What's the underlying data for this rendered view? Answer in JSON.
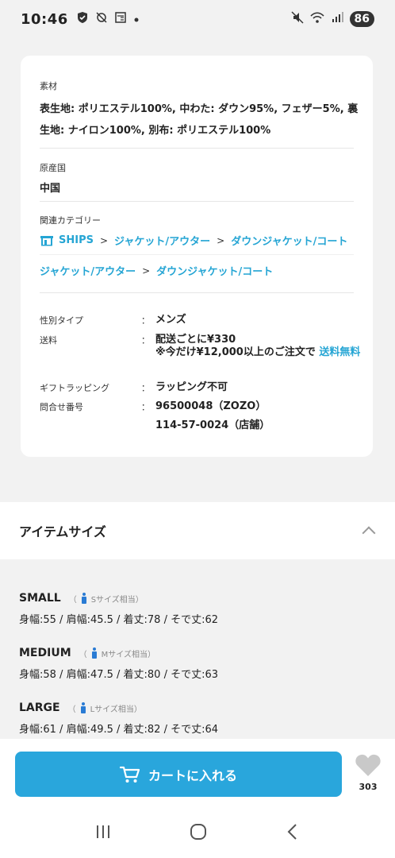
{
  "status_bar": {
    "time": "10:46",
    "battery": "86",
    "left_icons": [
      "shield-check-icon",
      "network-off-icon",
      "news-icon",
      "dot-icon"
    ],
    "right_icons": [
      "mute-icon",
      "wifi-icon",
      "signal-icon"
    ]
  },
  "details": {
    "material_label": "素材",
    "material_value_line1": "表生地: ポリエステル100%, 中わた: ダウン95%, フェザー5%, 裏",
    "material_value_line2": "生地: ナイロン100%, 別布: ポリエステル100%",
    "origin_label": "原産国",
    "origin_value": "中国",
    "category_label": "関連カテゴリー",
    "crumbs1": [
      "SHIPS",
      "ジャケット/アウター",
      "ダウンジャケット/コート"
    ],
    "crumbs2": [
      "ジャケット/アウター",
      "ダウンジャケット/コート"
    ],
    "crumb_sep": ">",
    "gender_key": "性別タイプ",
    "gender_val": "メンズ",
    "shipping_key": "送料",
    "shipping_val1": "配送ごとに¥330",
    "shipping_val2": "※今だけ¥12,000以上のご注文で",
    "shipping_link": "送料無料",
    "gift_key": "ギフトラッピング",
    "gift_val": "ラッピング不可",
    "inquiry_key": "問合せ番号",
    "inquiry_val1": "96500048（ZOZO）",
    "inquiry_val2": "114-57-0024（店舗）",
    "colon": "："
  },
  "item_size": {
    "title": "アイテムサイズ",
    "sizes": [
      {
        "name": "SMALL",
        "hint": "Sサイズ相当",
        "dims": "身幅:55 / 肩幅:45.5 / 着丈:78 / そで丈:62"
      },
      {
        "name": "MEDIUM",
        "hint": "Mサイズ相当",
        "dims": "身幅:58 / 肩幅:47.5 / 着丈:80 / そで丈:63"
      },
      {
        "name": "LARGE",
        "hint": "Lサイズ相当",
        "dims": "身幅:61 / 肩幅:49.5 / 着丈:82 / そで丈:64"
      }
    ],
    "paren_open": "（",
    "paren_close": "）"
  },
  "bottom": {
    "cart_label": "カートに入れる",
    "fav_count": "303"
  },
  "colors": {
    "accent": "#29a6dc",
    "link": "#25a5d4"
  }
}
